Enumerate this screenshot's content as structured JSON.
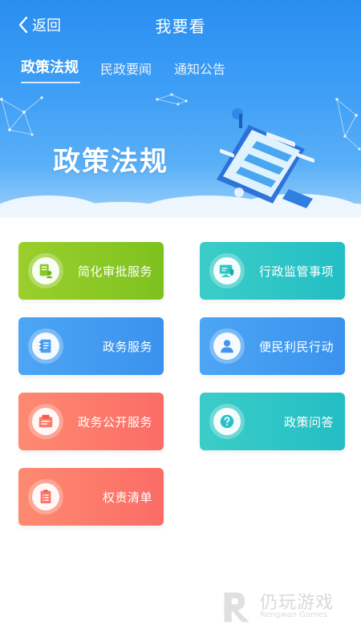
{
  "header": {
    "back_label": "返回",
    "title": "我要看",
    "tabs": [
      {
        "label": "政策法规",
        "active": true
      },
      {
        "label": "民政要闻",
        "active": false
      },
      {
        "label": "通知公告",
        "active": false
      }
    ]
  },
  "banner": {
    "title": "政策法规"
  },
  "services": [
    {
      "label": "简化审批服务",
      "color": "#8cc927",
      "icon": "document-user-icon"
    },
    {
      "label": "行政监管事项",
      "color": "#2fc6c6",
      "icon": "monitor-shield-icon"
    },
    {
      "label": "政务服务",
      "color": "#4a9ff2",
      "icon": "notebook-icon"
    },
    {
      "label": "便民利民行动",
      "color": "#3f96ee",
      "icon": "person-icon"
    },
    {
      "label": "政务公开服务",
      "color": "#fc7a6b",
      "icon": "file-tray-icon"
    },
    {
      "label": "政策问答",
      "color": "#28c2c6",
      "icon": "question-icon"
    },
    {
      "label": "权责清单",
      "color": "#fc7569",
      "icon": "clipboard-list-icon"
    }
  ],
  "watermark": {
    "logo": "仍玩游戏",
    "sub": "Rengwan Games"
  }
}
